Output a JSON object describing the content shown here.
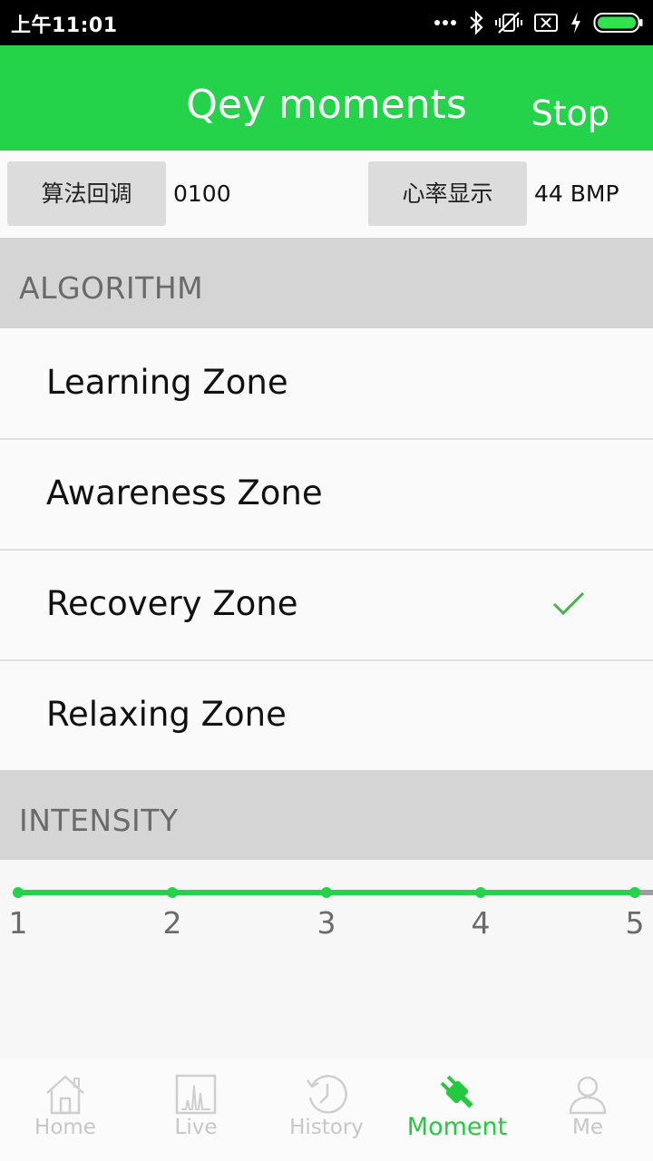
{
  "status_bar": {
    "time": "上午11:01",
    "icons": [
      "more-dots-icon",
      "bluetooth-icon",
      "vibrate-off-icon",
      "sim-x-icon",
      "charging-icon",
      "battery-icon"
    ]
  },
  "app_bar": {
    "title": "Qey moments",
    "action_label": "Stop"
  },
  "controls": {
    "algorithm_button": "算法回调",
    "algorithm_value": "0100",
    "heart_rate_button": "心率显示",
    "heart_rate_value": "44 BMP"
  },
  "algorithm_section": {
    "header": "ALGORITHM",
    "zones": [
      {
        "label": "Learning Zone",
        "selected": false
      },
      {
        "label": "Awareness Zone",
        "selected": false
      },
      {
        "label": "Recovery Zone",
        "selected": true
      },
      {
        "label": "Relaxing Zone",
        "selected": false
      }
    ]
  },
  "intensity_section": {
    "header": "INTENSITY",
    "ticks": [
      "1",
      "2",
      "3",
      "4",
      "5"
    ],
    "selected_level": 5
  },
  "bottom_nav": {
    "items": [
      {
        "label": "Home",
        "icon": "home-icon",
        "active": false
      },
      {
        "label": "Live",
        "icon": "live-chart-icon",
        "active": false
      },
      {
        "label": "History",
        "icon": "history-clock-icon",
        "active": false
      },
      {
        "label": "Moment",
        "icon": "plug-icon",
        "active": true
      },
      {
        "label": "Me",
        "icon": "person-icon",
        "active": false
      }
    ]
  },
  "colors": {
    "accent": "#25d34a",
    "section_bg": "#d5d5d5",
    "check": "#4caf50"
  }
}
